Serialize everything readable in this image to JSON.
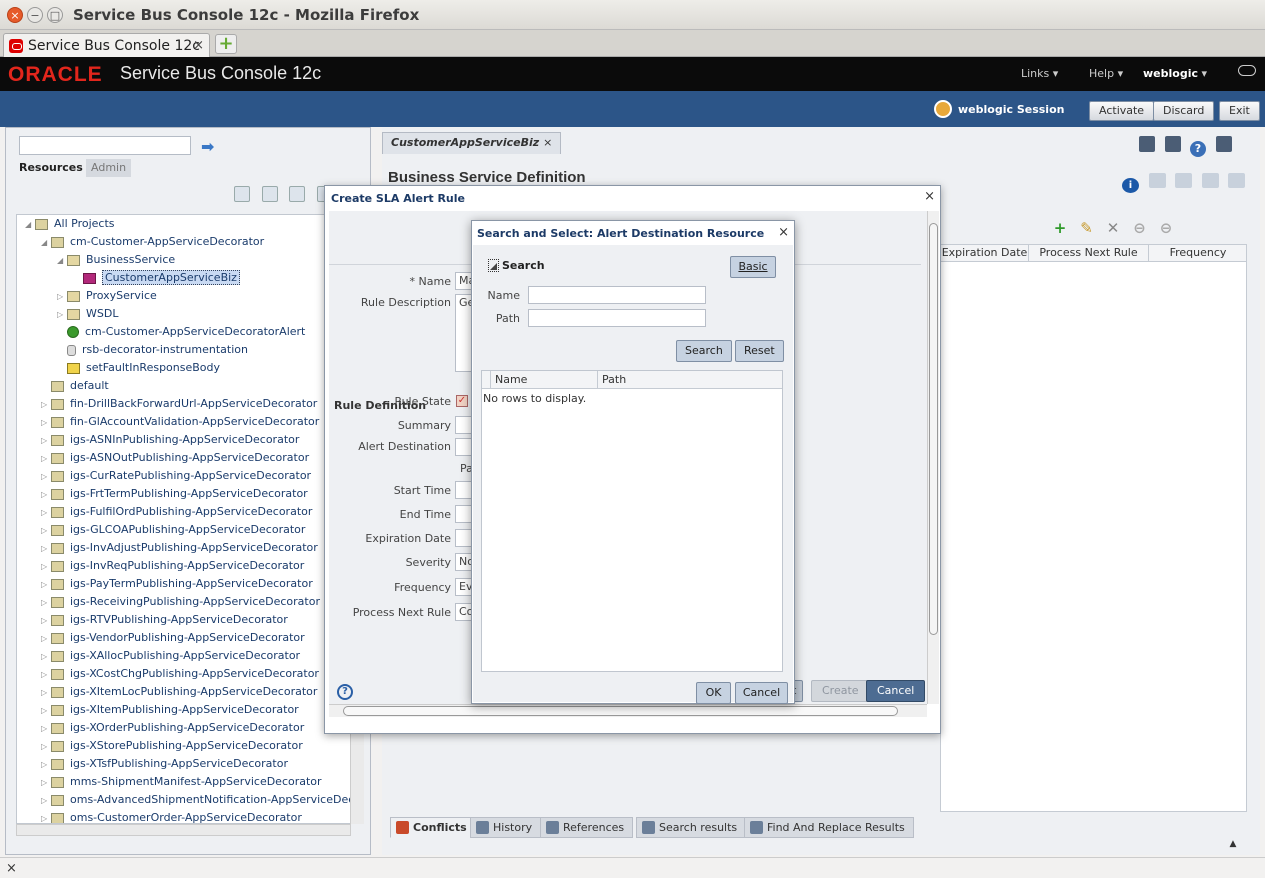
{
  "browser": {
    "window_title": "Service Bus Console 12c - Mozilla Firefox",
    "tab_label": "Service Bus Console 12c"
  },
  "header": {
    "logo": "ORACLE",
    "app_title": "Service Bus Console 12c",
    "menus": [
      "Links",
      "Help",
      "weblogic"
    ]
  },
  "session": {
    "user_label": "weblogic Session",
    "buttons": [
      "Activate",
      "Discard",
      "Exit"
    ]
  },
  "left": {
    "tabs": [
      "Resources",
      "Admin"
    ],
    "tree": [
      {
        "label": "All Projects",
        "level": 0,
        "icon": "project-icon",
        "expanded": true
      },
      {
        "label": "cm-Customer-AppServiceDecorator",
        "level": 1,
        "icon": "project-icon",
        "expanded": true
      },
      {
        "label": "BusinessService",
        "level": 2,
        "icon": "folder-icon",
        "expanded": true
      },
      {
        "label": "CustomerAppServiceBiz",
        "level": 3,
        "icon": "business-service-icon",
        "selected": true
      },
      {
        "label": "ProxyService",
        "level": 2,
        "icon": "folder-icon"
      },
      {
        "label": "WSDL",
        "level": 2,
        "icon": "folder-icon"
      },
      {
        "label": "cm-Customer-AppServiceDecoratorAlert",
        "level": 2,
        "icon": "alert-icon"
      },
      {
        "label": "rsb-decorator-instrumentation",
        "level": 2,
        "icon": "database-icon"
      },
      {
        "label": "setFaultInResponseBody",
        "level": 2,
        "icon": "function-icon"
      },
      {
        "label": "default",
        "level": 1,
        "icon": "project-icon"
      },
      {
        "label": "fin-DrillBackForwardUrl-AppServiceDecorator",
        "level": 1,
        "icon": "project-icon"
      },
      {
        "label": "fin-GlAccountValidation-AppServiceDecorator",
        "level": 1,
        "icon": "project-icon"
      },
      {
        "label": "igs-ASNInPublishing-AppServiceDecorator",
        "level": 1,
        "icon": "project-icon"
      },
      {
        "label": "igs-ASNOutPublishing-AppServiceDecorator",
        "level": 1,
        "icon": "project-icon"
      },
      {
        "label": "igs-CurRatePublishing-AppServiceDecorator",
        "level": 1,
        "icon": "project-icon"
      },
      {
        "label": "igs-FrtTermPublishing-AppServiceDecorator",
        "level": 1,
        "icon": "project-icon"
      },
      {
        "label": "igs-FulfilOrdPublishing-AppServiceDecorator",
        "level": 1,
        "icon": "project-icon"
      },
      {
        "label": "igs-GLCOAPublishing-AppServiceDecorator",
        "level": 1,
        "icon": "project-icon"
      },
      {
        "label": "igs-InvAdjustPublishing-AppServiceDecorator",
        "level": 1,
        "icon": "project-icon"
      },
      {
        "label": "igs-InvReqPublishing-AppServiceDecorator",
        "level": 1,
        "icon": "project-icon"
      },
      {
        "label": "igs-PayTermPublishing-AppServiceDecorator",
        "level": 1,
        "icon": "project-icon"
      },
      {
        "label": "igs-ReceivingPublishing-AppServiceDecorator",
        "level": 1,
        "icon": "project-icon"
      },
      {
        "label": "igs-RTVPublishing-AppServiceDecorator",
        "level": 1,
        "icon": "project-icon"
      },
      {
        "label": "igs-VendorPublishing-AppServiceDecorator",
        "level": 1,
        "icon": "project-icon"
      },
      {
        "label": "igs-XAllocPublishing-AppServiceDecorator",
        "level": 1,
        "icon": "project-icon"
      },
      {
        "label": "igs-XCostChgPublishing-AppServiceDecorator",
        "level": 1,
        "icon": "project-icon"
      },
      {
        "label": "igs-XItemLocPublishing-AppServiceDecorator",
        "level": 1,
        "icon": "project-icon"
      },
      {
        "label": "igs-XItemPublishing-AppServiceDecorator",
        "level": 1,
        "icon": "project-icon"
      },
      {
        "label": "igs-XOrderPublishing-AppServiceDecorator",
        "level": 1,
        "icon": "project-icon"
      },
      {
        "label": "igs-XStorePublishing-AppServiceDecorator",
        "level": 1,
        "icon": "project-icon"
      },
      {
        "label": "igs-XTsfPublishing-AppServiceDecorator",
        "level": 1,
        "icon": "project-icon"
      },
      {
        "label": "mms-ShipmentManifest-AppServiceDecorator",
        "level": 1,
        "icon": "project-icon"
      },
      {
        "label": "oms-AdvancedShipmentNotification-AppServiceDecorato",
        "level": 1,
        "icon": "project-icon"
      },
      {
        "label": "oms-CustomerOrder-AppServiceDecorator",
        "level": 1,
        "icon": "project-icon"
      }
    ]
  },
  "right": {
    "doc_tab": "CustomerAppServiceBiz",
    "heading": "Business Service Definition",
    "grid_columns": [
      "Expiration Date",
      "Process Next Rule",
      "Frequency"
    ],
    "bottom_tabs": [
      "Conflicts",
      "History",
      "References",
      "Search results",
      "Find And Replace Results"
    ]
  },
  "sla_dialog": {
    "title": "Create SLA Alert Rule",
    "name_label": "* Name",
    "name_value": "Ma",
    "rule_description_label": "Rule Description",
    "rule_description_value": "Ge",
    "rule_definition_heading": "Rule Definition",
    "rule_state_label": "Rule State",
    "summary_label": "Summary",
    "alert_destination_label": "Alert Destination",
    "alert_destination_sub": "Pa",
    "start_time_label": "Start Time",
    "end_time_label": "End Time",
    "expiration_date_label": "Expiration Date",
    "severity_label": "Severity",
    "severity_value": "No",
    "frequency_label": "Frequency",
    "frequency_value": "Ev",
    "process_next_rule_label": "Process Next Rule",
    "process_next_rule_value": "Co",
    "create_button": "Create",
    "cancel_button": "Cancel",
    "partial_button": "t"
  },
  "search_dialog": {
    "title": "Search and Select: Alert Destination Resource",
    "search_heading": "Search",
    "basic_button": "Basic",
    "name_label": "Name",
    "path_label": "Path",
    "search_button": "Search",
    "reset_button": "Reset",
    "columns": [
      "Name",
      "Path"
    ],
    "empty_text": "No rows to display.",
    "ok_button": "OK",
    "cancel_button": "Cancel"
  }
}
